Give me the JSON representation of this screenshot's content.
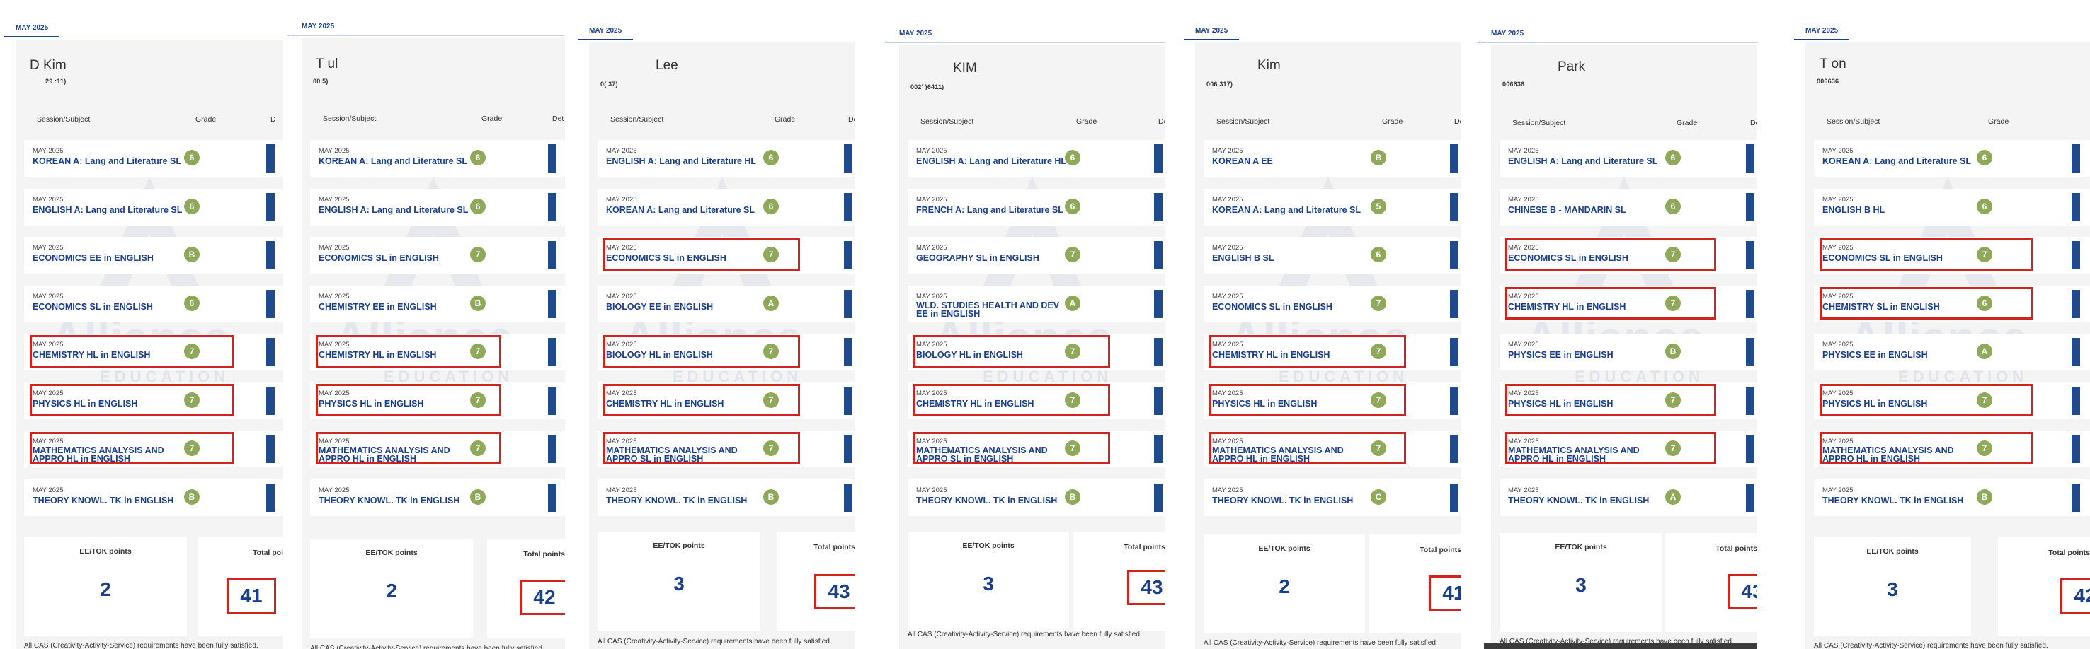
{
  "panels": [
    {
      "tab": "MAY 2025",
      "name": "D          Kim",
      "id": "29           :11)",
      "headers": {
        "session": "Session/Subject",
        "grade": "Grade",
        "details": "D"
      },
      "rows": [
        {
          "session": "MAY 2025",
          "subject": "KOREAN A: Lang and Literature SL",
          "grade": "6",
          "hl": false
        },
        {
          "session": "MAY 2025",
          "subject": "ENGLISH A: Lang and Literature SL",
          "grade": "6",
          "hl": false
        },
        {
          "session": "MAY 2025",
          "subject": "ECONOMICS EE in ENGLISH",
          "grade": "B",
          "hl": false
        },
        {
          "session": "MAY 2025",
          "subject": "ECONOMICS SL in ENGLISH",
          "grade": "6",
          "hl": false
        },
        {
          "session": "MAY 2025",
          "subject": "CHEMISTRY HL in ENGLISH",
          "grade": "7",
          "hl": true
        },
        {
          "session": "MAY 2025",
          "subject": "PHYSICS HL in ENGLISH",
          "grade": "7",
          "hl": true
        },
        {
          "session": "MAY 2025",
          "subject": "MATHEMATICS ANALYSIS AND APPRO HL in ENGLISH",
          "grade": "7",
          "hl": true
        },
        {
          "session": "MAY 2025",
          "subject": "THEORY KNOWL. TK in ENGLISH",
          "grade": "B",
          "hl": false
        }
      ],
      "ee_label": "EE/TOK points",
      "ee_points": "2",
      "total_label": "Total poi",
      "total": "41",
      "cas": "All CAS (Creativity-Activity-Service) requirements have been fully satisfied."
    },
    {
      "tab": "MAY 2025",
      "name": "T         ul",
      "id": "00                 5)",
      "headers": {
        "session": "Session/Subject",
        "grade": "Grade",
        "details": "Det"
      },
      "rows": [
        {
          "session": "MAY 2025",
          "subject": "KOREAN A: Lang and Literature SL",
          "grade": "6",
          "hl": false
        },
        {
          "session": "MAY 2025",
          "subject": "ENGLISH A: Lang and Literature SL",
          "grade": "6",
          "hl": false
        },
        {
          "session": "MAY 2025",
          "subject": "ECONOMICS SL in ENGLISH",
          "grade": "7",
          "hl": false
        },
        {
          "session": "MAY 2025",
          "subject": "CHEMISTRY EE in ENGLISH",
          "grade": "B",
          "hl": false
        },
        {
          "session": "MAY 2025",
          "subject": "CHEMISTRY HL in ENGLISH",
          "grade": "7",
          "hl": true
        },
        {
          "session": "MAY 2025",
          "subject": "PHYSICS HL in ENGLISH",
          "grade": "7",
          "hl": true
        },
        {
          "session": "MAY 2025",
          "subject": "MATHEMATICS ANALYSIS AND APPRO HL in ENGLISH",
          "grade": "7",
          "hl": true
        },
        {
          "session": "MAY 2025",
          "subject": "THEORY KNOWL. TK in ENGLISH",
          "grade": "B",
          "hl": false
        }
      ],
      "ee_label": "EE/TOK points",
      "ee_points": "2",
      "total_label": "Total points",
      "total": "42",
      "cas": "All CAS (Creativity-Activity-Service) requirements have been fully satisfied."
    },
    {
      "tab": "MAY 2025",
      "name": "Lee",
      "id": "0(                  37)",
      "headers": {
        "session": "Session/Subject",
        "grade": "Grade",
        "details": "Det"
      },
      "rows": [
        {
          "session": "MAY 2025",
          "subject": "ENGLISH A: Lang and Literature HL",
          "grade": "6",
          "hl": false
        },
        {
          "session": "MAY 2025",
          "subject": "KOREAN A: Lang and Literature SL",
          "grade": "6",
          "hl": false
        },
        {
          "session": "MAY 2025",
          "subject": "ECONOMICS SL in ENGLISH",
          "grade": "7",
          "hl": true
        },
        {
          "session": "MAY 2025",
          "subject": "BIOLOGY EE in ENGLISH",
          "grade": "A",
          "hl": false
        },
        {
          "session": "MAY 2025",
          "subject": "BIOLOGY HL in ENGLISH",
          "grade": "7",
          "hl": true
        },
        {
          "session": "MAY 2025",
          "subject": "CHEMISTRY HL in ENGLISH",
          "grade": "7",
          "hl": true
        },
        {
          "session": "MAY 2025",
          "subject": "MATHEMATICS ANALYSIS AND APPRO SL in ENGLISH",
          "grade": "7",
          "hl": true
        },
        {
          "session": "MAY 2025",
          "subject": "THEORY KNOWL. TK in ENGLISH",
          "grade": "B",
          "hl": false
        }
      ],
      "ee_label": "EE/TOK points",
      "ee_points": "3",
      "total_label": "Total points",
      "total": "43",
      "cas": "All CAS (Creativity-Activity-Service) requirements have been fully satisfied."
    },
    {
      "tab": "MAY 2025",
      "name": "KIM",
      "id": "002'              )6411)",
      "headers": {
        "session": "Session/Subject",
        "grade": "Grade",
        "details": "Det"
      },
      "rows": [
        {
          "session": "MAY 2025",
          "subject": "ENGLISH A: Lang and Literature HL",
          "grade": "6",
          "hl": false
        },
        {
          "session": "MAY 2025",
          "subject": "FRENCH A: Lang and Literature SL",
          "grade": "6",
          "hl": false
        },
        {
          "session": "MAY 2025",
          "subject": "GEOGRAPHY SL in ENGLISH",
          "grade": "7",
          "hl": false
        },
        {
          "session": "MAY 2025",
          "subject": "WLD. STUDIES HEALTH AND DEV EE in ENGLISH",
          "grade": "A",
          "hl": false
        },
        {
          "session": "MAY 2025",
          "subject": "BIOLOGY HL in ENGLISH",
          "grade": "7",
          "hl": true
        },
        {
          "session": "MAY 2025",
          "subject": "CHEMISTRY HL in ENGLISH",
          "grade": "7",
          "hl": true
        },
        {
          "session": "MAY 2025",
          "subject": "MATHEMATICS ANALYSIS AND APPRO SL in ENGLISH",
          "grade": "7",
          "hl": true
        },
        {
          "session": "MAY 2025",
          "subject": "THEORY KNOWL. TK in ENGLISH",
          "grade": "B",
          "hl": false
        }
      ],
      "ee_label": "EE/TOK points",
      "ee_points": "3",
      "total_label": "Total points",
      "total": "43",
      "cas": "All CAS (Creativity-Activity-Service) requirements have been fully satisfied."
    },
    {
      "tab": "MAY 2025",
      "name": "Kim",
      "id": "006               317)",
      "headers": {
        "session": "Session/Subject",
        "grade": "Grade",
        "details": "Det"
      },
      "rows": [
        {
          "session": "MAY 2025",
          "subject": "KOREAN A EE",
          "grade": "B",
          "hl": false
        },
        {
          "session": "MAY 2025",
          "subject": "KOREAN A: Lang and Literature SL",
          "grade": "5",
          "hl": false
        },
        {
          "session": "MAY 2025",
          "subject": "ENGLISH B SL",
          "grade": "6",
          "hl": false
        },
        {
          "session": "MAY 2025",
          "subject": "ECONOMICS SL in ENGLISH",
          "grade": "7",
          "hl": false
        },
        {
          "session": "MAY 2025",
          "subject": "CHEMISTRY HL in ENGLISH",
          "grade": "7",
          "hl": true
        },
        {
          "session": "MAY 2025",
          "subject": "PHYSICS HL in ENGLISH",
          "grade": "7",
          "hl": true
        },
        {
          "session": "MAY 2025",
          "subject": "MATHEMATICS ANALYSIS AND APPRO HL in ENGLISH",
          "grade": "7",
          "hl": true
        },
        {
          "session": "MAY 2025",
          "subject": "THEORY KNOWL. TK in ENGLISH",
          "grade": "C",
          "hl": false
        }
      ],
      "ee_label": "EE/TOK points",
      "ee_points": "2",
      "total_label": "Total points",
      "total": "41",
      "cas": "All CAS (Creativity-Activity-Service) requirements have been fully satisfied."
    },
    {
      "tab": "MAY 2025",
      "name": "Park",
      "id": "006636",
      "headers": {
        "session": "Session/Subject",
        "grade": "Grade",
        "details": "De"
      },
      "rows": [
        {
          "session": "MAY 2025",
          "subject": "ENGLISH A: Lang and Literature SL",
          "grade": "6",
          "hl": false
        },
        {
          "session": "MAY 2025",
          "subject": "CHINESE B - MANDARIN SL",
          "grade": "6",
          "hl": false
        },
        {
          "session": "MAY 2025",
          "subject": "ECONOMICS SL in ENGLISH",
          "grade": "7",
          "hl": true
        },
        {
          "session": "MAY 2025",
          "subject": "CHEMISTRY HL in ENGLISH",
          "grade": "7",
          "hl": true
        },
        {
          "session": "MAY 2025",
          "subject": "PHYSICS EE in ENGLISH",
          "grade": "B",
          "hl": false
        },
        {
          "session": "MAY 2025",
          "subject": "PHYSICS HL in ENGLISH",
          "grade": "7",
          "hl": true
        },
        {
          "session": "MAY 2025",
          "subject": "MATHEMATICS ANALYSIS AND APPRO HL in ENGLISH",
          "grade": "7",
          "hl": true
        },
        {
          "session": "MAY 2025",
          "subject": "THEORY KNOWL. TK in ENGLISH",
          "grade": "A",
          "hl": false
        }
      ],
      "ee_label": "EE/TOK points",
      "ee_points": "3",
      "total_label": "Total points",
      "total": "43",
      "cas": "All CAS (Creativity-Activity-Service) requirements have been fully satisfied."
    },
    {
      "tab": "MAY 2025",
      "name": "T       on",
      "id": "006636",
      "headers": {
        "session": "Session/Subject",
        "grade": "Grade",
        "details": ""
      },
      "rows": [
        {
          "session": "MAY 2025",
          "subject": "KOREAN A: Lang and Literature SL",
          "grade": "6",
          "hl": false
        },
        {
          "session": "MAY 2025",
          "subject": "ENGLISH B HL",
          "grade": "6",
          "hl": false
        },
        {
          "session": "MAY 2025",
          "subject": "ECONOMICS SL in ENGLISH",
          "grade": "7",
          "hl": true
        },
        {
          "session": "MAY 2025",
          "subject": "CHEMISTRY SL in ENGLISH",
          "grade": "6",
          "hl": true
        },
        {
          "session": "MAY 2025",
          "subject": "PHYSICS EE in ENGLISH",
          "grade": "A",
          "hl": false
        },
        {
          "session": "MAY 2025",
          "subject": "PHYSICS HL in ENGLISH",
          "grade": "7",
          "hl": true
        },
        {
          "session": "MAY 2025",
          "subject": "MATHEMATICS ANALYSIS AND APPRO HL in ENGLISH",
          "grade": "7",
          "hl": true
        },
        {
          "session": "MAY 2025",
          "subject": "THEORY KNOWL. TK in ENGLISH",
          "grade": "B",
          "hl": false
        }
      ],
      "ee_label": "EE/TOK points",
      "ee_points": "3",
      "total_label": "Total points",
      "total": "42",
      "cas": "All CAS (Creativity-Activity-Service) requirements have been fully satisfied."
    }
  ],
  "watermark": {
    "word": "Alliance",
    "sub": "EDUCATION"
  },
  "colors": {
    "accent": "#1a3f8a",
    "grade_badge": "#8fa85a",
    "highlight": "#d0251f",
    "detail_bar": "#1f4a8c"
  }
}
